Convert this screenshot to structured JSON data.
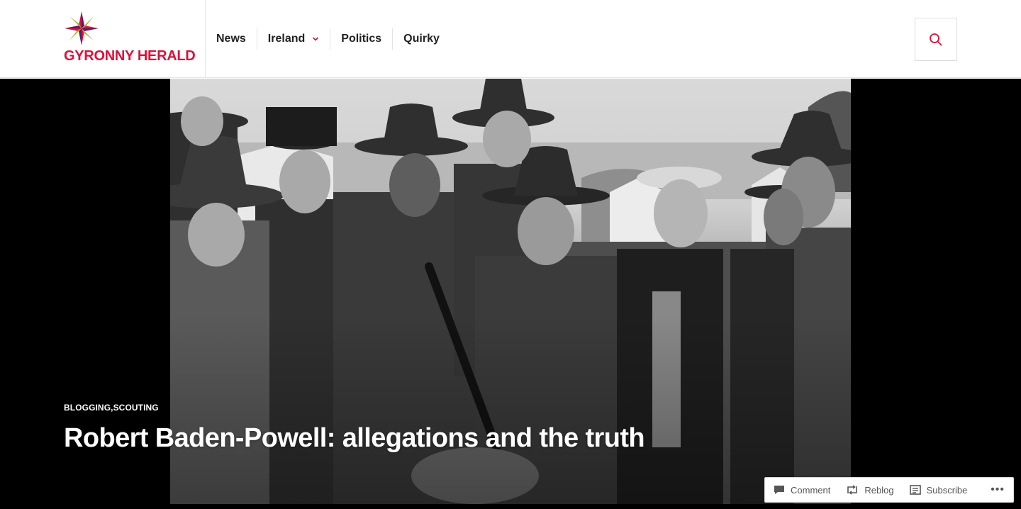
{
  "site": {
    "title": "GYRONNY HERALD",
    "accent_color": "#d5133c",
    "logo_colors": [
      "#d5133c",
      "#5b1a6b",
      "#c7a12a"
    ]
  },
  "nav": {
    "items": [
      {
        "label": "News"
      },
      {
        "label": "Ireland",
        "has_dropdown": true
      },
      {
        "label": "Politics"
      },
      {
        "label": "Quirky"
      }
    ],
    "search_icon": "search-icon"
  },
  "post": {
    "categories": [
      "BLOGGING",
      "SCOUTING"
    ],
    "category_separator": ",",
    "title": "Robert Baden-Powell: allegations and the truth"
  },
  "actionbar": {
    "comment": "Comment",
    "reblog": "Reblog",
    "subscribe": "Subscribe",
    "more": "•••"
  }
}
